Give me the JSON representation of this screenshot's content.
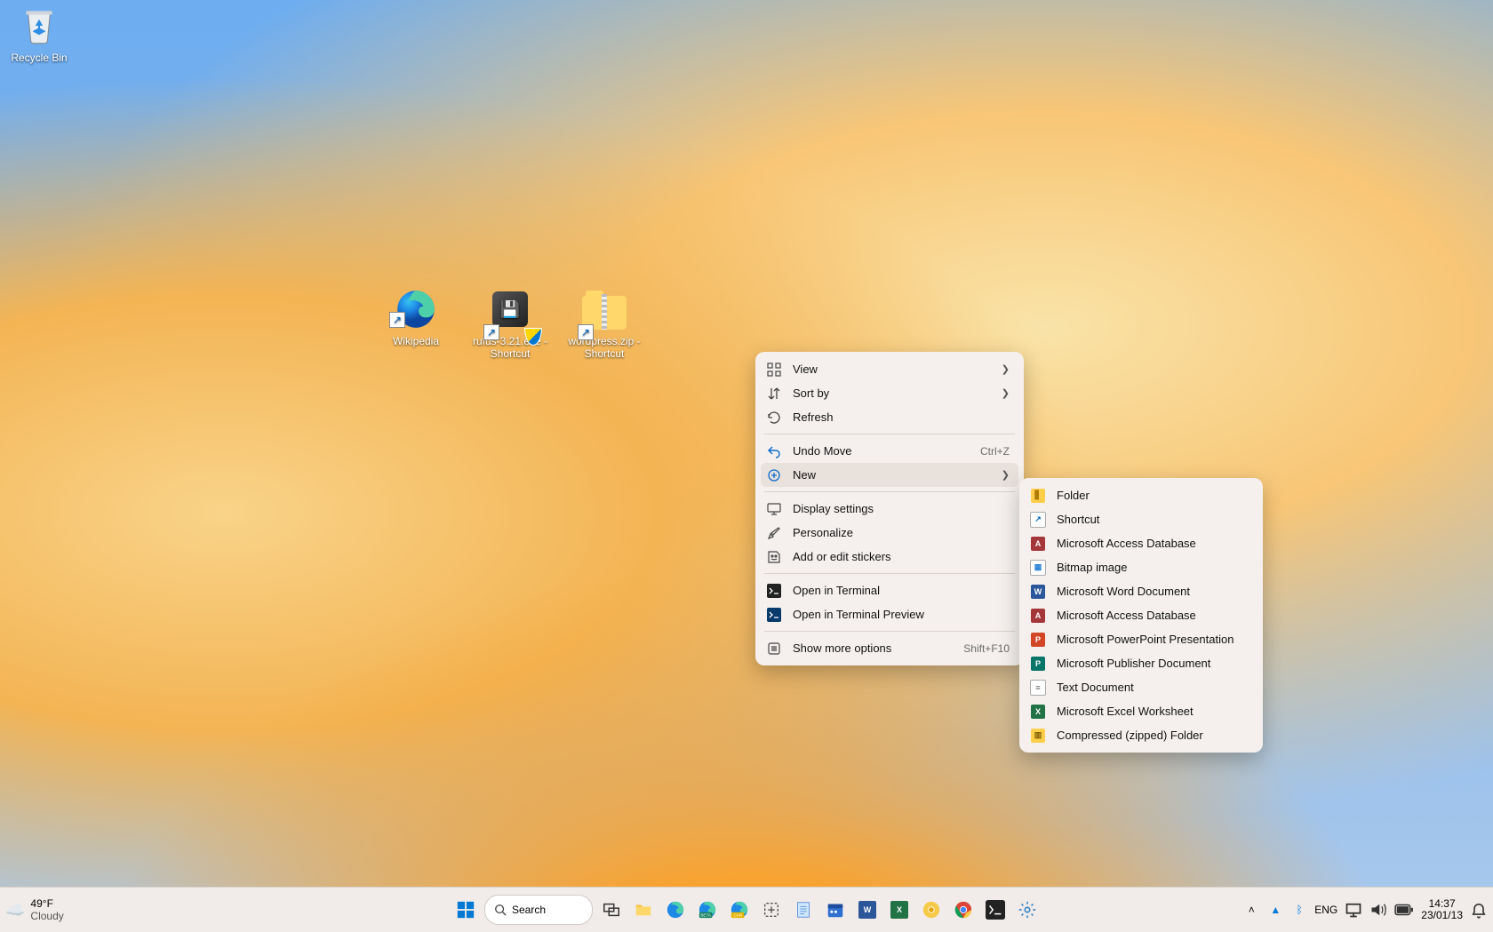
{
  "desktop": {
    "icons": {
      "recycle_bin": "Recycle Bin",
      "wikipedia": "Wikipedia",
      "rufus": "rufus-3.21.exe - Shortcut",
      "wordpress": "wordpress.zip - Shortcut"
    }
  },
  "context_menu": {
    "view": "View",
    "sort_by": "Sort by",
    "refresh": "Refresh",
    "undo_move": "Undo Move",
    "undo_move_hint": "Ctrl+Z",
    "new": "New",
    "display_settings": "Display settings",
    "personalize": "Personalize",
    "add_stickers": "Add or edit stickers",
    "open_terminal": "Open in Terminal",
    "open_terminal_preview": "Open in Terminal Preview",
    "show_more": "Show more options",
    "show_more_hint": "Shift+F10"
  },
  "new_submenu": {
    "folder": "Folder",
    "shortcut": "Shortcut",
    "access1": "Microsoft Access Database",
    "bitmap": "Bitmap image",
    "word": "Microsoft Word Document",
    "access2": "Microsoft Access Database",
    "ppt": "Microsoft PowerPoint Presentation",
    "publisher": "Microsoft Publisher Document",
    "text": "Text Document",
    "excel": "Microsoft Excel Worksheet",
    "zip": "Compressed (zipped) Folder"
  },
  "taskbar": {
    "weather_temp": "49°F",
    "weather_desc": "Cloudy",
    "search": "Search",
    "lang": "ENG",
    "time": "14:37",
    "date": "23/01/13"
  }
}
